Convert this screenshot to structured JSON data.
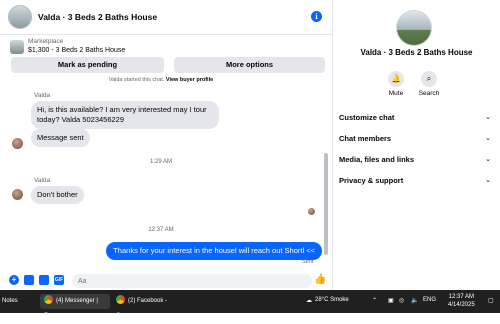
{
  "header": {
    "title": "Valda · 3 Beds 2 Baths House",
    "info_icon": "info-icon"
  },
  "listing": {
    "source": "Marketplace",
    "title": "$1,300 - 3 Beds 2 Baths House"
  },
  "actions": {
    "mark_pending": "Mark as pending",
    "more_options": "More options"
  },
  "conversation": {
    "started_note": "Valda started this chat.",
    "view_profile": "View buyer profile",
    "messages": [
      {
        "sender": "Valda",
        "text": "Hi, is this available? I am very interested may I tour today? Valda 5023456229"
      },
      {
        "text": "Message sent"
      },
      {
        "timestamp": "1:29 AM"
      },
      {
        "sender": "Valda",
        "text": "Don't bother"
      },
      {
        "timestamp": "12:37 AM"
      },
      {
        "text": "Thanks for your interest in the housel will reach out Shortl <<",
        "status": "Sent"
      }
    ]
  },
  "composer": {
    "placeholder": "Aa"
  },
  "right_panel": {
    "title": "Valda · 3 Beds 2 Baths House",
    "mute_label": "Mute",
    "search_label": "Search",
    "sections": [
      "Customize chat",
      "Chat members",
      "Media, files and links",
      "Privacy & support"
    ]
  },
  "taskbar": {
    "notes_label": "Notes",
    "messenger_tab": "(4) Messenger | Fac...",
    "facebook_tab": "(2) Facebook - Goo...",
    "weather": "28°C  Smoke",
    "language": "ENG",
    "time": "12:37 AM",
    "date": "4/14/2025"
  },
  "colors": {
    "accent": "#0866ff",
    "bubble_in": "#e4e6eb",
    "taskbar": "#202020"
  }
}
